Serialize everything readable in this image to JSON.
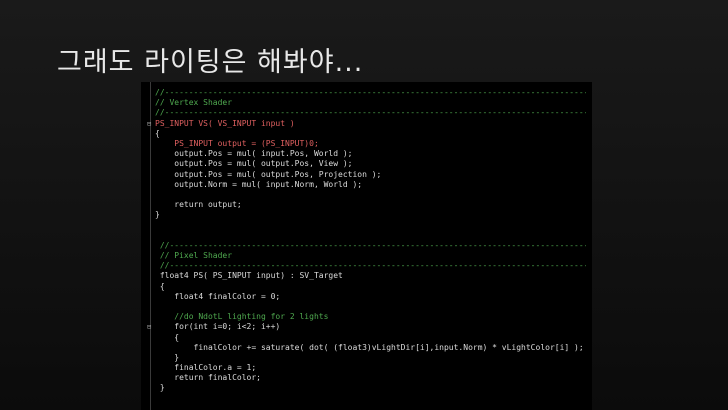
{
  "slide": {
    "title": "그래도 라이팅은 해봐야..."
  },
  "code": {
    "lines": [
      {
        "fold": "",
        "text": "//-----------------------------------------------------------------------------------------",
        "cls": "comment"
      },
      {
        "fold": "",
        "text": "// Vertex Shader",
        "cls": "comment"
      },
      {
        "fold": "",
        "text": "//-----------------------------------------------------------------------------------------",
        "cls": "comment"
      },
      {
        "fold": "⊟",
        "text": "PS_INPUT VS( VS_INPUT input )",
        "cls": "type"
      },
      {
        "fold": "",
        "text": "{",
        "cls": ""
      },
      {
        "fold": "",
        "text": "    PS_INPUT output = (PS_INPUT)0;",
        "cls": "type"
      },
      {
        "fold": "",
        "text": "    output.Pos = mul( input.Pos, World );",
        "cls": ""
      },
      {
        "fold": "",
        "text": "    output.Pos = mul( output.Pos, View );",
        "cls": ""
      },
      {
        "fold": "",
        "text": "    output.Pos = mul( output.Pos, Projection );",
        "cls": ""
      },
      {
        "fold": "",
        "text": "    output.Norm = mul( input.Norm, World );",
        "cls": ""
      },
      {
        "fold": "",
        "text": "",
        "cls": ""
      },
      {
        "fold": "",
        "text": "    return output;",
        "cls": ""
      },
      {
        "fold": "",
        "text": "}",
        "cls": ""
      },
      {
        "fold": "",
        "text": "",
        "cls": ""
      },
      {
        "fold": "",
        "text": "",
        "cls": ""
      },
      {
        "fold": "",
        "text": " //-----------------------------------------------------------------------------------------",
        "cls": "comment"
      },
      {
        "fold": "",
        "text": " // Pixel Shader",
        "cls": "comment"
      },
      {
        "fold": "",
        "text": " //-----------------------------------------------------------------------------------------",
        "cls": "comment"
      },
      {
        "fold": "",
        "text": " float4 PS( PS_INPUT input) : SV_Target",
        "cls": ""
      },
      {
        "fold": "",
        "text": " {",
        "cls": ""
      },
      {
        "fold": "",
        "text": "    float4 finalColor = 0;",
        "cls": ""
      },
      {
        "fold": "",
        "text": "",
        "cls": ""
      },
      {
        "fold": "",
        "text": "    //do NdotL lighting for 2 lights",
        "cls": "comment"
      },
      {
        "fold": "⊟",
        "text": "    for(int i=0; i<2; i++)",
        "cls": ""
      },
      {
        "fold": "",
        "text": "    {",
        "cls": ""
      },
      {
        "fold": "",
        "text": "        finalColor += saturate( dot( (float3)vLightDir[i],input.Norm) * vLightColor[i] );",
        "cls": ""
      },
      {
        "fold": "",
        "text": "    }",
        "cls": ""
      },
      {
        "fold": "",
        "text": "    finalColor.a = 1;",
        "cls": ""
      },
      {
        "fold": "",
        "text": "    return finalColor;",
        "cls": ""
      },
      {
        "fold": "",
        "text": " }",
        "cls": ""
      }
    ]
  },
  "colors": {
    "comment": "#4fa94f",
    "type": "#e06060",
    "background": "#000000",
    "slide_bg": "#141414",
    "title": "#e8e8e8"
  }
}
